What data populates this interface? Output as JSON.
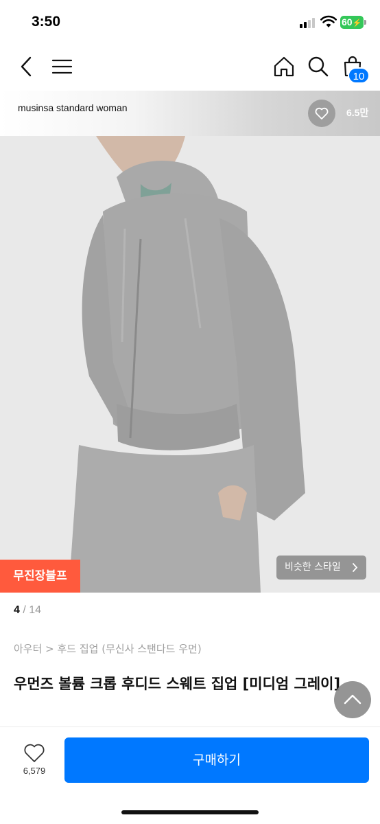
{
  "status_bar": {
    "time": "3:50",
    "battery": "60",
    "icons": [
      "signal-icon",
      "wifi-icon",
      "battery-icon"
    ]
  },
  "nav": {
    "icons": [
      "back-icon",
      "menu-icon",
      "home-icon",
      "search-icon",
      "shopping-bag-icon"
    ],
    "cart_count": "10"
  },
  "brand": {
    "name": "musinsa standard woman",
    "like_count": "6.5만",
    "icon": "heart-icon"
  },
  "gallery": {
    "promo_tag": "무진장블프",
    "similar_style": "비슷한 스타일",
    "current": "4",
    "separator": "/",
    "total": "14"
  },
  "product": {
    "breadcrumb": "아우터 > 후드 집업 (무신사 스탠다드 우먼)",
    "title": "우먼즈 볼륨 크롭 후디드 스웨트 집업 [미디엄 그레이]"
  },
  "bottom_bar": {
    "like_count": "6,579",
    "buy_label": "구매하기"
  },
  "colors": {
    "accent": "#0078ff",
    "promo": "#ff5a3d",
    "battery": "#34c759"
  }
}
